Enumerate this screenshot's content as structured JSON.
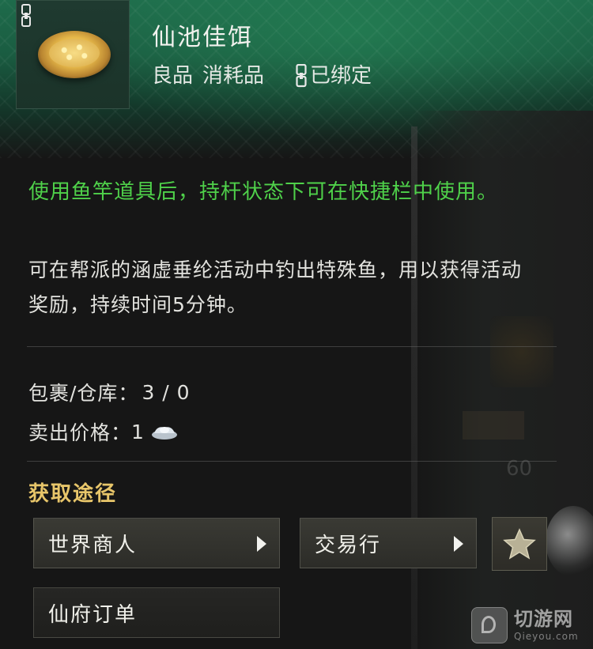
{
  "item": {
    "name": "仙池佳饵",
    "quality": "良品",
    "category": "消耗品",
    "bind_status": "已绑定",
    "icon": "fish-bait-dish-icon"
  },
  "description": {
    "usage": "使用鱼竿道具后，持杆状态下可在快捷栏中使用。",
    "effect": "可在帮派的涵虚垂纶活动中钓出特殊鱼，用以获得活动奖励，持续时间5分钟。"
  },
  "stats": {
    "storage_label": "包裹/仓库：",
    "storage_value": "3 / 0",
    "price_label": "卖出价格：",
    "price_value": "1",
    "price_icon": "silver-ingot-icon"
  },
  "sources": {
    "title": "获取途径",
    "items": [
      {
        "label": "世界商人"
      },
      {
        "label": "交易行"
      },
      {
        "label": "仙府订单"
      }
    ],
    "favorite_icon": "star-icon"
  },
  "background": {
    "faded_number": "60"
  },
  "watermark": {
    "cn": "切游网",
    "en": "Qieyou.com"
  },
  "colors": {
    "usage_text": "#4fd14a",
    "section_title": "#e8c66a",
    "header_green": "#1e6b4b"
  }
}
